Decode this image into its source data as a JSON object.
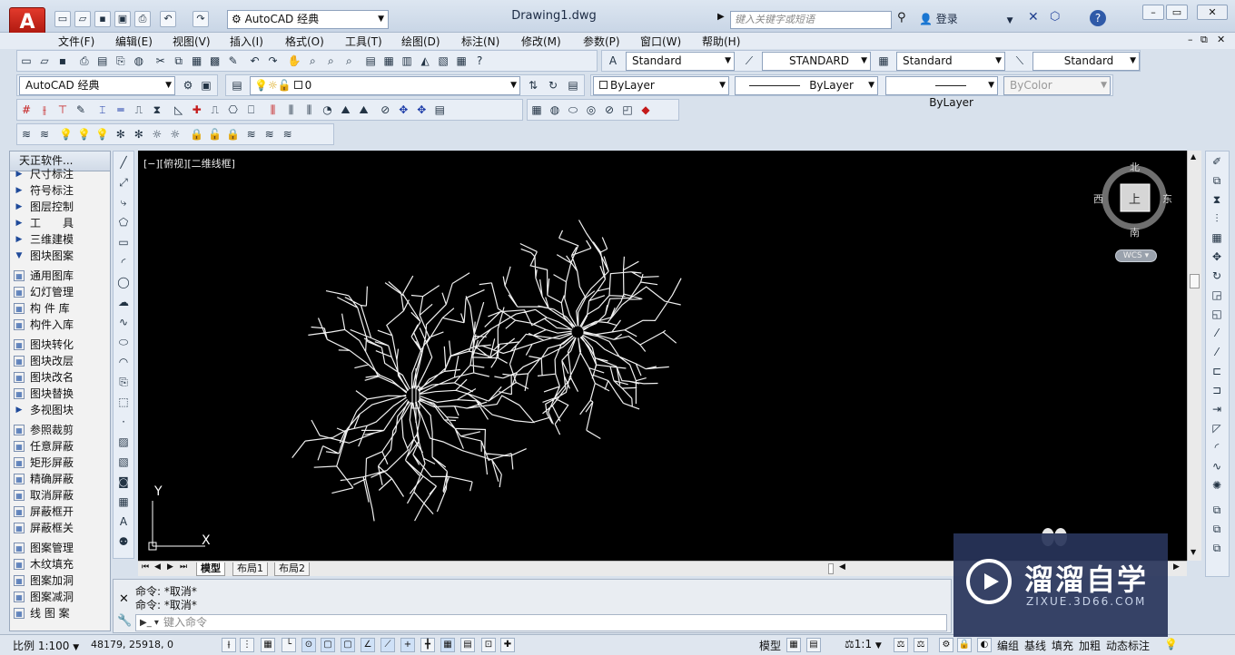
{
  "titlebar": {
    "app_logo": "A",
    "workspace": "AutoCAD 经典",
    "document_title": "Drawing1.dwg",
    "search_placeholder": "键入关键字或短语",
    "login_label": "登录"
  },
  "menubar": {
    "items": [
      "文件(F)",
      "编辑(E)",
      "视图(V)",
      "插入(I)",
      "格式(O)",
      "工具(T)",
      "绘图(D)",
      "标注(N)",
      "修改(M)",
      "参数(P)",
      "窗口(W)",
      "帮助(H)"
    ]
  },
  "styles_toolbar": {
    "text_style": "Standard",
    "dim_style": "STANDARD",
    "table_style": "Standard",
    "mleader_style": "Standard"
  },
  "layers_toolbar": {
    "workspace": "AutoCAD 经典",
    "layer": "0",
    "color": "ByLayer",
    "linetype": "ByLayer",
    "lineweight": "ByLayer",
    "plotstyle": "ByColor"
  },
  "palette": {
    "title": "天正软件...",
    "items": [
      {
        "label": "尺寸标注",
        "kind": "arrow"
      },
      {
        "label": "符号标注",
        "kind": "arrow"
      },
      {
        "label": "图层控制",
        "kind": "arrow"
      },
      {
        "label": "工　　具",
        "kind": "arrow"
      },
      {
        "label": "三维建模",
        "kind": "arrow"
      },
      {
        "label": "图块图案",
        "kind": "open"
      },
      {
        "label": "通用图库",
        "kind": "cmd"
      },
      {
        "label": "幻灯管理",
        "kind": "cmd"
      },
      {
        "label": "构 件 库",
        "kind": "cmd"
      },
      {
        "label": "构件入库",
        "kind": "cmd"
      },
      {
        "label": "图块转化",
        "kind": "cmd"
      },
      {
        "label": "图块改层",
        "kind": "cmd"
      },
      {
        "label": "图块改名",
        "kind": "cmd"
      },
      {
        "label": "图块替换",
        "kind": "cmd"
      },
      {
        "label": "多视图块",
        "kind": "arrow"
      },
      {
        "label": "参照裁剪",
        "kind": "cmd"
      },
      {
        "label": "任意屏蔽",
        "kind": "cmd"
      },
      {
        "label": "矩形屏蔽",
        "kind": "cmd"
      },
      {
        "label": "精确屏蔽",
        "kind": "cmd"
      },
      {
        "label": "取消屏蔽",
        "kind": "cmd"
      },
      {
        "label": "屏蔽框开",
        "kind": "cmd"
      },
      {
        "label": "屏蔽框关",
        "kind": "cmd"
      },
      {
        "label": "图案管理",
        "kind": "cmd"
      },
      {
        "label": "木纹填充",
        "kind": "cmd"
      },
      {
        "label": "图案加洞",
        "kind": "cmd"
      },
      {
        "label": "图案减洞",
        "kind": "cmd"
      },
      {
        "label": "线 图 案",
        "kind": "cmd"
      }
    ]
  },
  "viewport": {
    "label": "[−][俯视][二维线框]",
    "viewcube": {
      "north": "北",
      "south": "南",
      "east": "东",
      "west": "西",
      "top": "上",
      "wcs": "WCS"
    },
    "ucs": {
      "x": "X",
      "y": "Y"
    }
  },
  "layout_tabs": [
    "模型",
    "布局1",
    "布局2"
  ],
  "command": {
    "history": [
      "命令: *取消*",
      "命令: *取消*"
    ],
    "input_placeholder": "键入命令"
  },
  "statusbar": {
    "scale": "比例 1:100",
    "coords": "48179, 25918, 0",
    "model_label": "模型",
    "annotation_scale": "1:1",
    "toggles": [
      "编组",
      "基线",
      "填充",
      "加粗",
      "动态标注"
    ]
  },
  "watermark": {
    "text": "溜溜自学",
    "sub": "ZIXUE.3D66.COM"
  }
}
